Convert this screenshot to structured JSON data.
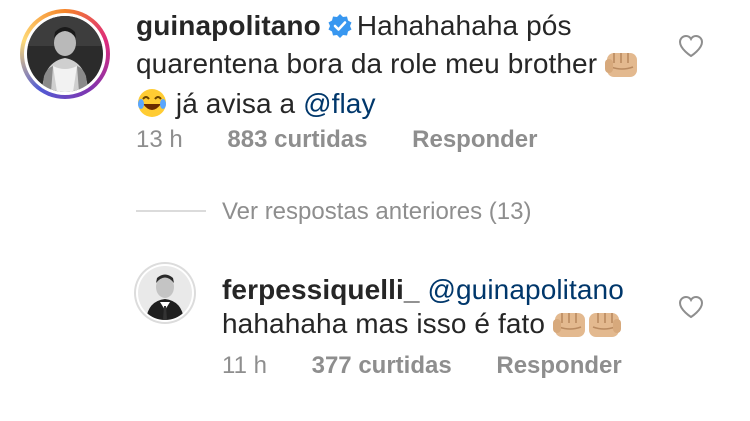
{
  "comments": [
    {
      "username": "guinapolitano",
      "verified": true,
      "text_line1": "Hahahahaha pós",
      "text_line2": "quarentena bora da role meu brother",
      "text_line3_prefix": "já avisa a ",
      "text_line3_mention": "@flay",
      "time": "13 h",
      "likes": "883 curtidas",
      "reply": "Responder",
      "emojis": [
        "fist-bump-icon",
        "laughing-face-icon"
      ]
    },
    {
      "username": "ferpessiquelli_",
      "mention": "@guinapolitano",
      "text": "hahahaha mas isso é fato",
      "time": "11 h",
      "likes": "377 curtidas",
      "reply": "Responder",
      "emojis": [
        "fist-bump-icon",
        "fist-bump-icon"
      ]
    }
  ],
  "view_replies": "Ver respostas anteriores (13)",
  "colors": {
    "text": "#262626",
    "secondary": "#8e8e8e",
    "mention": "#00376b",
    "verified": "#3897f0",
    "divider": "#dbdbdb"
  }
}
